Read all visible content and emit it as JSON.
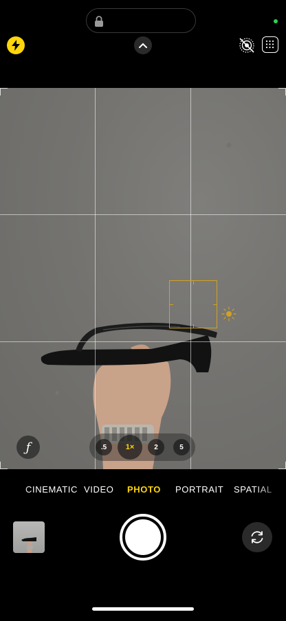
{
  "top_bar": {
    "lock_icon": "lock-icon",
    "flash_icon": "bolt-icon",
    "controls_icon": "chevron-up-icon",
    "live_photo_icon": "live-photo-off-icon",
    "styles_icon": "photographic-styles-icon",
    "indicator_color": "#2ed158",
    "accent_color": "#ffd60a"
  },
  "viewfinder": {
    "grid": "3x3",
    "focus_color": "#d1a21e",
    "exposure_icon": "sun-icon",
    "aperture_label": "ƒ",
    "zoom_levels": [
      ".5",
      "1×",
      "2",
      "5"
    ],
    "zoom_selected": "1×"
  },
  "modes": [
    "CINEMATIC",
    "VIDEO",
    "PHOTO",
    "PORTRAIT",
    "SPATIAL"
  ],
  "mode_selected": "PHOTO",
  "bottom": {
    "thumbnail_icon": "last-photo-thumbnail",
    "shutter_icon": "shutter-button",
    "flip_icon": "camera-flip-icon"
  }
}
